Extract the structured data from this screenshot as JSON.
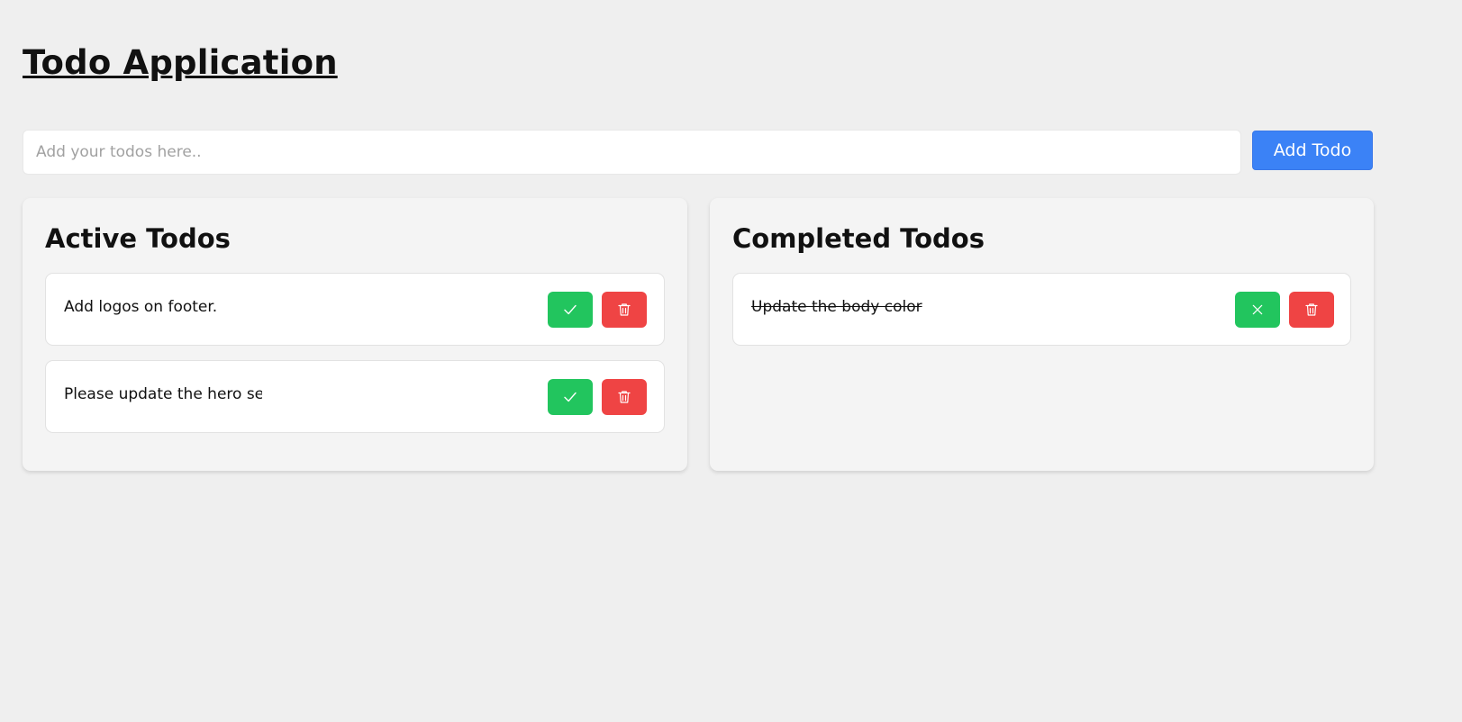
{
  "app": {
    "title": "Todo Application"
  },
  "input": {
    "placeholder": "Add your todos here..",
    "value": ""
  },
  "add_button": {
    "label": "Add Todo"
  },
  "active": {
    "heading": "Active Todos",
    "items": [
      {
        "text": "Add logos on footer.",
        "complete_icon": "check-icon",
        "delete_icon": "trash-icon"
      },
      {
        "text": "Please update the hero sect",
        "complete_icon": "check-icon",
        "delete_icon": "trash-icon"
      }
    ]
  },
  "completed": {
    "heading": "Completed Todos",
    "items": [
      {
        "text": "Update the body color",
        "undo_icon": "x-icon",
        "delete_icon": "trash-icon"
      }
    ]
  },
  "colors": {
    "background": "#efefef",
    "panel": "#f4f4f4",
    "primary": "#3b82f6",
    "success": "#22c55e",
    "danger": "#ef4444"
  }
}
